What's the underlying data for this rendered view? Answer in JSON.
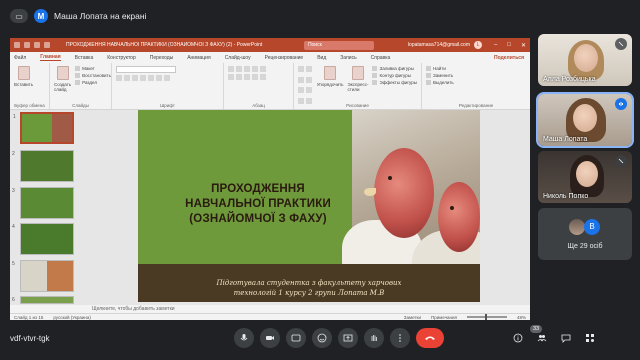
{
  "banner": {
    "user_initial": "M",
    "text": "Маша Лопата на екрані"
  },
  "ppt": {
    "window_title": "ПРОХОДЖЕННЯ НАВЧАЛЬНОЇ ПРАКТИКИ (ОЗНАЙОМЧОЇ З ФАХУ) (2) - PowerPoint",
    "search_placeholder": "Поиск",
    "account_email": "lopatamasa714@gmail.com",
    "account_initial": "L",
    "menu": [
      "Файл",
      "Главная",
      "Вставка",
      "Конструктор",
      "Переходы",
      "Анимация",
      "Слайд-шоу",
      "Рецензирование",
      "Вид",
      "Запись",
      "Справка"
    ],
    "share_label": "Поделиться",
    "ribbon": {
      "paste": "Вставить",
      "clipboard_items": [
        "Макет",
        "Восстановить",
        "Раздел"
      ],
      "new_slide": "Создать слайд",
      "groups": [
        "Буфер обмена",
        "Слайды",
        "Шрифт",
        "Абзац",
        "Рисование",
        "Редактирование"
      ],
      "arrange": "Упорядочить",
      "styles": "Экспресс-стили",
      "shape_items": [
        "Заливка фигуры",
        "Контур фигуры",
        "Эффекты фигуры"
      ],
      "edit_items": [
        "Найти",
        "Заменить",
        "Выделить"
      ]
    },
    "thumb_numbers": [
      "1",
      "2",
      "3",
      "4",
      "5",
      "6"
    ],
    "slide": {
      "title_lines": [
        "ПРОХОДЖЕННЯ",
        "НАВЧАЛЬНОЇ ПРАКТИКИ",
        "(ОЗНАЙОМЧОЇ З ФАХУ)"
      ],
      "caption_lines": [
        "Підготувала студентка з факультету харчових",
        "технологій 1 курсу 2 групи  Лопата М.В"
      ]
    },
    "notes_placeholder": "Щелкните, чтобы добавить заметки",
    "status": {
      "slide_of": "Слайд 1 из 15",
      "language": "русский (Украина)",
      "notes": "Заметки",
      "comments": "Примечания",
      "zoom": "48%"
    }
  },
  "participants": [
    {
      "name": "Алла Розбицька",
      "speaking": false
    },
    {
      "name": "Маша Лопата",
      "speaking": true
    },
    {
      "name": "Николь Попко",
      "speaking": false
    }
  ],
  "others": {
    "initial": "B",
    "label": "Ще 29 осіб"
  },
  "meeting": {
    "code": "vdf-vtvr-tgk",
    "participant_count": "33"
  },
  "colors": {
    "ppt_red": "#b7472a",
    "meet_bg": "#202124",
    "end_call": "#ea4335"
  }
}
